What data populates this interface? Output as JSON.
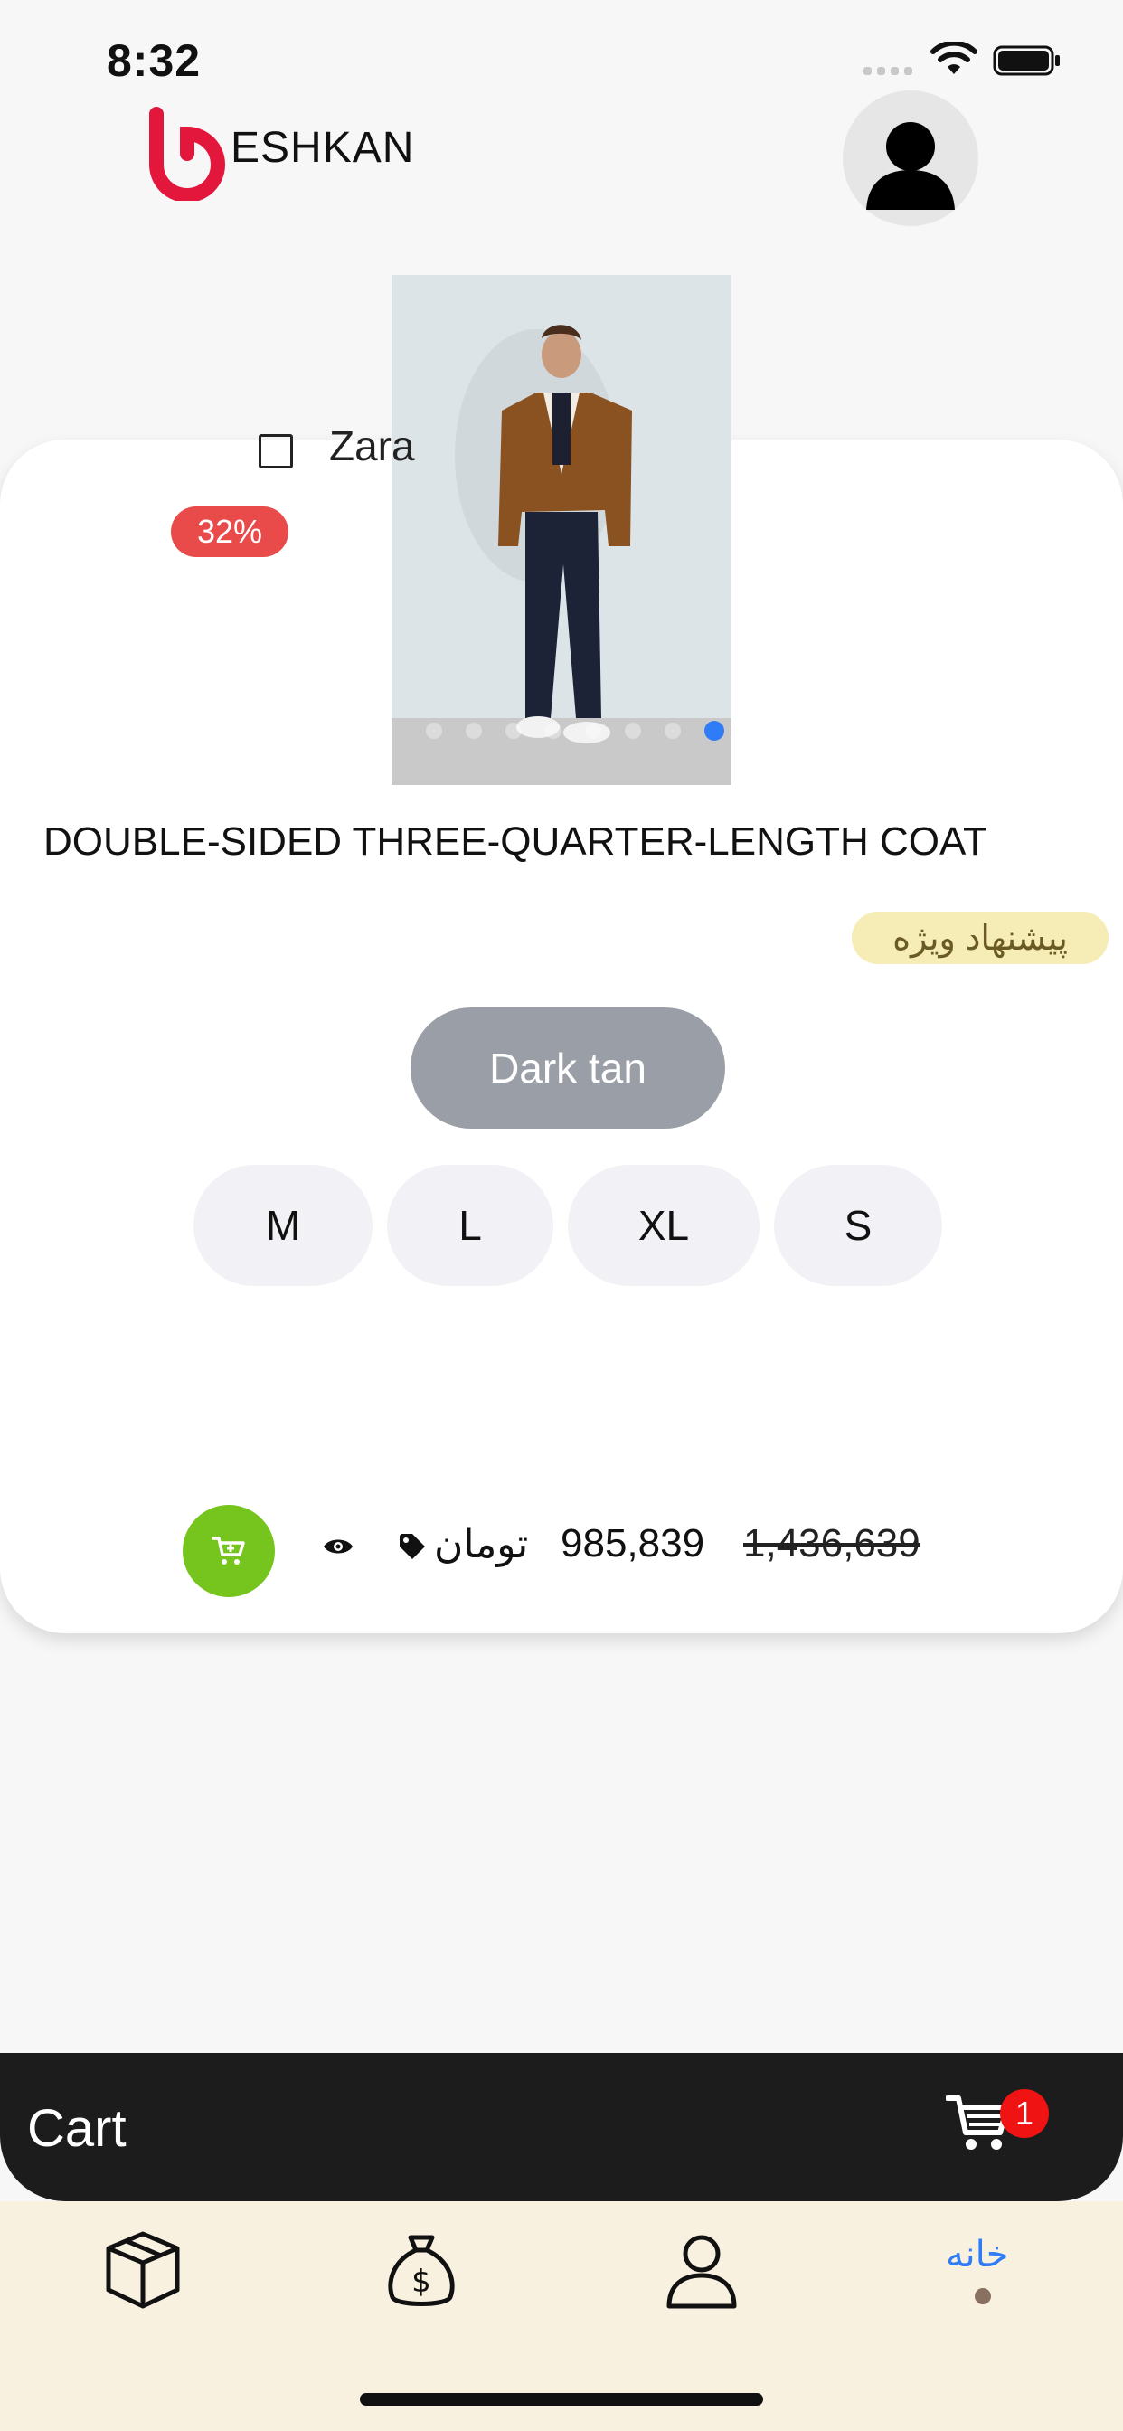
{
  "status_bar": {
    "time": "8:32"
  },
  "header": {
    "logo_text": "ESHKAN"
  },
  "product": {
    "brand": "Zara",
    "discount_badge": "32%",
    "title": "DOUBLE-SIDED THREE-QUARTER-LENGTH COAT",
    "special_offer_label": "پیشنهاد ویژه",
    "color_selected": "Dark tan",
    "sizes": [
      "M",
      "L",
      "XL",
      "S"
    ],
    "currency": "تومان",
    "price": "985,839",
    "old_price": "1,436,639"
  },
  "cart_bar": {
    "label": "Cart",
    "badge_count": "1"
  },
  "tabbar": {
    "home_label": "خانه"
  },
  "colors": {
    "discount_badge": "#e94b4b",
    "special_offer_bg": "#f6ecb6",
    "color_button": "#9a9ea6",
    "add_to_cart": "#76c41e",
    "cart_bar": "#1c1c1c",
    "tabbar": "#f8f1e0",
    "accent_blue": "#2f7cf6",
    "badge_red": "#f01313"
  },
  "icons": {
    "wifi": "wifi-icon",
    "battery": "battery-icon",
    "avatar": "user-avatar-icon",
    "cart": "cart-icon",
    "eye": "eye-icon",
    "tag": "tag-icon",
    "box": "box-icon",
    "money_bag": "money-bag-icon",
    "user": "user-icon"
  }
}
